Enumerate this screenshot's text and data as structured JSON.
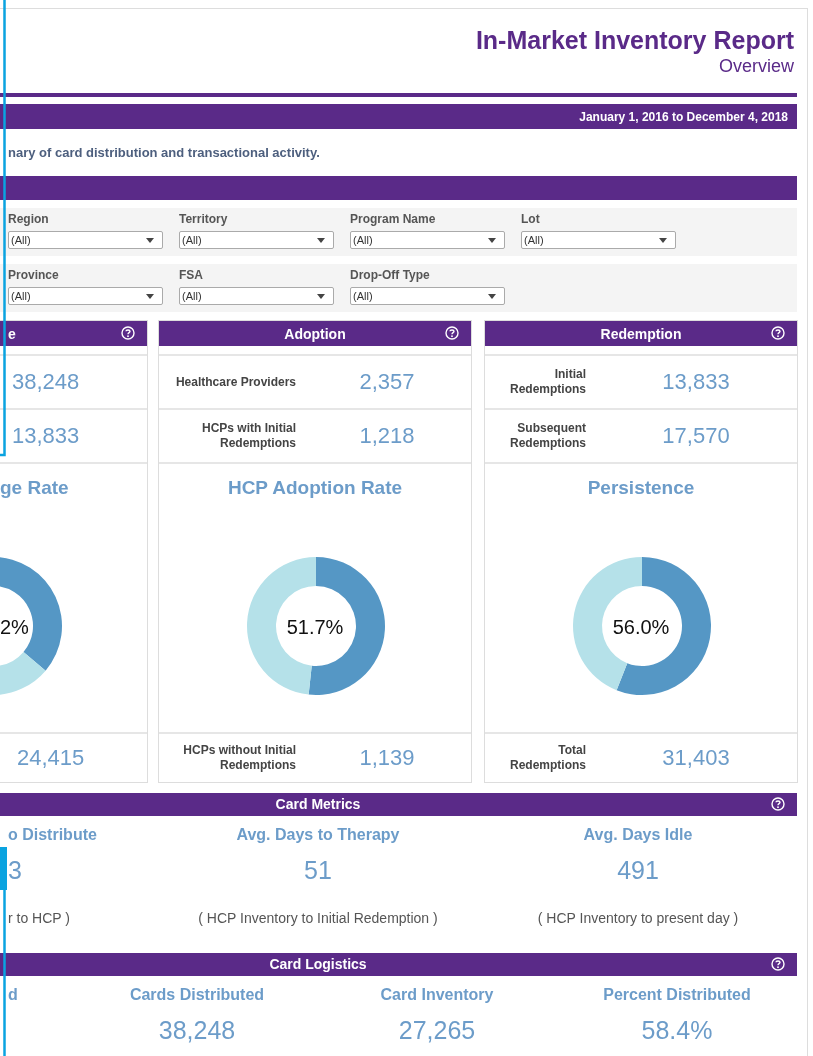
{
  "header": {
    "title": "In-Market Inventory Report",
    "subtitle": "Overview"
  },
  "date_range": "January 1, 2016 to December 4, 2018",
  "description": "nary of card distribution and transactional activity.",
  "filters": [
    [
      {
        "label": "Region",
        "value": "(All)"
      },
      {
        "label": "Territory",
        "value": "(All)"
      },
      {
        "label": "Program Name",
        "value": "(All)"
      },
      {
        "label": "Lot",
        "value": "(All)"
      }
    ],
    [
      {
        "label": "Province",
        "value": "(All)"
      },
      {
        "label": "FSA",
        "value": "(All)"
      },
      {
        "label": "Drop-Off Type",
        "value": "(All)"
      }
    ]
  ],
  "cards": [
    {
      "kind": "partial",
      "title": "e",
      "rows": [
        {
          "value": "38,248"
        },
        {
          "value": "13,833"
        }
      ],
      "chart_title": "ge Rate",
      "center_label": "2%",
      "footer": {
        "value": "24,415"
      }
    },
    {
      "kind": "full",
      "title": "Adoption",
      "rows": [
        {
          "label": "Healthcare Providers",
          "value": "2,357"
        },
        {
          "label": "HCPs with Initial Redemptions",
          "value": "1,218"
        }
      ],
      "chart_title": "HCP Adoption Rate",
      "center_label": "51.7%",
      "chart_data": {
        "type": "donut",
        "values": [
          51.7,
          48.3
        ]
      },
      "footer": {
        "label": "HCPs without Initial Redemptions",
        "value": "1,139"
      }
    },
    {
      "kind": "full",
      "title": "Redemption",
      "rows": [
        {
          "label": "Initial Redemptions",
          "value": "13,833"
        },
        {
          "label": "Subsequent Redemptions",
          "value": "17,570"
        }
      ],
      "chart_title": "Persistence",
      "center_label": "56.0%",
      "chart_data": {
        "type": "donut",
        "values": [
          56.0,
          44.0
        ]
      },
      "footer": {
        "label": "Total Redemptions",
        "value": "31,403"
      }
    }
  ],
  "metrics": {
    "title": "Card Metrics",
    "items": [
      {
        "title": "o Distribute",
        "value": "3",
        "note": "r to HCP )"
      },
      {
        "title": "Avg. Days to Therapy",
        "value": "51",
        "note": "( HCP Inventory to Initial Redemption )"
      },
      {
        "title": "Avg. Days Idle",
        "value": "491",
        "note": "( HCP Inventory to present day )"
      }
    ]
  },
  "logistics": {
    "title": "Card Logistics",
    "items": [
      {
        "title": "d"
      },
      {
        "title": "Cards Distributed",
        "value": "38,248"
      },
      {
        "title": "Card Inventory",
        "value": "27,265"
      },
      {
        "title": "Percent Distributed",
        "value": "58.4%"
      }
    ]
  }
}
